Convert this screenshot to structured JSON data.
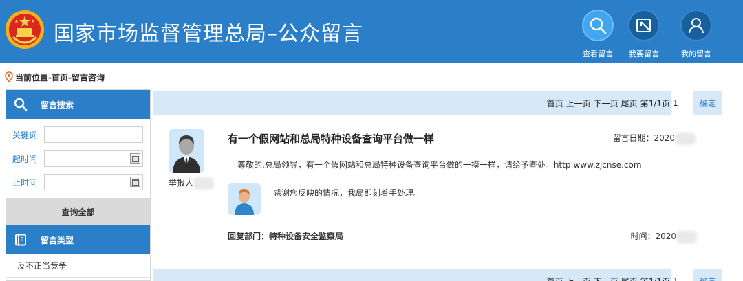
{
  "header": {
    "title": "国家市场监督管理总局–公众留言",
    "nav": [
      {
        "label": "查看留言",
        "icon": "search-icon",
        "active": true
      },
      {
        "label": "我要留言",
        "icon": "write-icon",
        "active": false
      },
      {
        "label": "我的留言",
        "icon": "user-icon",
        "active": false
      }
    ]
  },
  "breadcrumb": "当前位置-首页-留言咨询",
  "sidebar": {
    "search_title": "留言搜索",
    "keyword_label": "关键词",
    "start_label": "起时间",
    "end_label": "止时间",
    "query_all": "查询全部",
    "type_title": "留言类型",
    "types": [
      "反不正当竞争"
    ]
  },
  "pager": {
    "first": "首页",
    "prev": "上一页",
    "next": "下一页",
    "last": "尾页",
    "info": "第1/1页",
    "page_value": "1",
    "confirm": "确定"
  },
  "message": {
    "title": "有一个假网站和总局特种设备查询平台做一样",
    "date_label": "留言日期：2020",
    "poster": "举报人",
    "body": "尊敬的,总局领导，有一个假网站和总局特种设备查询平台做的一摸一样，请给予查处。http:www.zjcnse.com",
    "reply": "感谢您反映的情况，我局即刻着手处理。",
    "reply_dept": "回复部门：特种设备安全监察局",
    "reply_time": "时间：2020"
  },
  "colors": {
    "header_bg": "#2a7fc8",
    "pager_bg": "#d7e9f7",
    "accent": "#2a7fc8"
  }
}
